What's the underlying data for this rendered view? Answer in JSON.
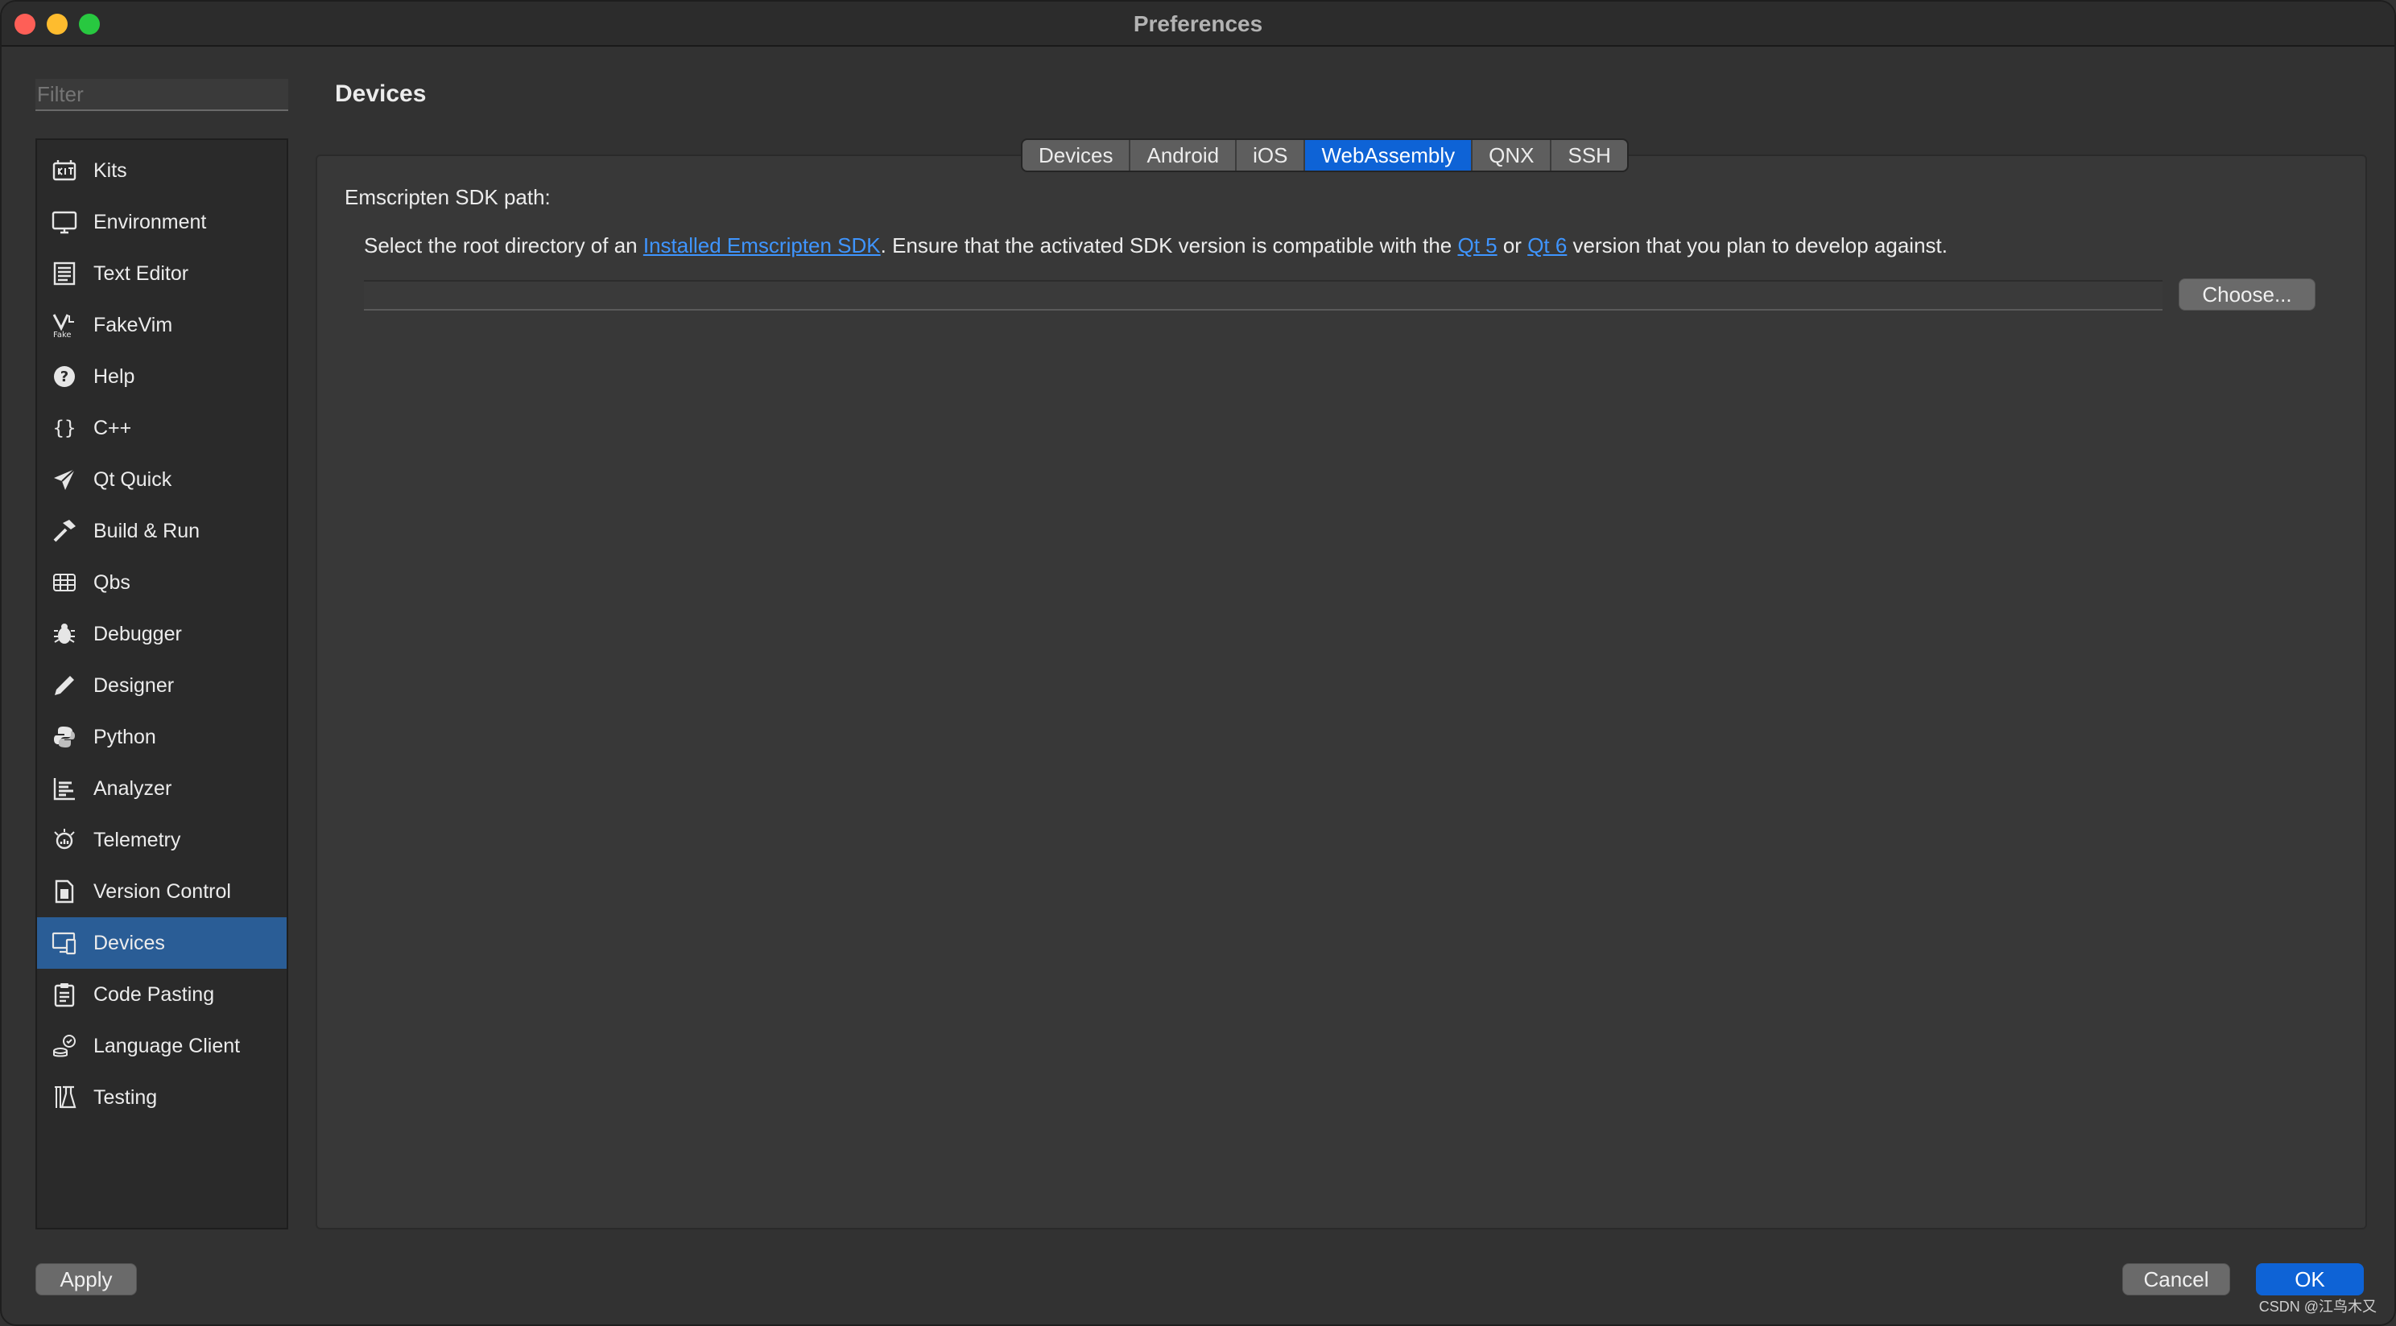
{
  "window": {
    "title": "Preferences"
  },
  "sidebar": {
    "filter_placeholder": "Filter",
    "items": [
      {
        "label": "Kits",
        "icon": "kits-icon"
      },
      {
        "label": "Environment",
        "icon": "monitor-icon"
      },
      {
        "label": "Text Editor",
        "icon": "text-editor-icon"
      },
      {
        "label": "FakeVim",
        "icon": "fakevim-icon"
      },
      {
        "label": "Help",
        "icon": "help-icon"
      },
      {
        "label": "C++",
        "icon": "braces-icon"
      },
      {
        "label": "Qt Quick",
        "icon": "paper-plane-icon"
      },
      {
        "label": "Build & Run",
        "icon": "hammer-icon"
      },
      {
        "label": "Qbs",
        "icon": "qbs-grid-icon"
      },
      {
        "label": "Debugger",
        "icon": "bug-icon"
      },
      {
        "label": "Designer",
        "icon": "pencil-icon"
      },
      {
        "label": "Python",
        "icon": "python-icon"
      },
      {
        "label": "Analyzer",
        "icon": "analyzer-icon"
      },
      {
        "label": "Telemetry",
        "icon": "telemetry-icon"
      },
      {
        "label": "Version Control",
        "icon": "version-control-icon"
      },
      {
        "label": "Devices",
        "icon": "devices-icon",
        "selected": true
      },
      {
        "label": "Code Pasting",
        "icon": "clipboard-icon"
      },
      {
        "label": "Language Client",
        "icon": "language-client-icon"
      },
      {
        "label": "Testing",
        "icon": "flask-icon"
      }
    ]
  },
  "main": {
    "title": "Devices",
    "tabs": [
      {
        "label": "Devices"
      },
      {
        "label": "Android"
      },
      {
        "label": "iOS"
      },
      {
        "label": "WebAssembly",
        "active": true
      },
      {
        "label": "QNX"
      },
      {
        "label": "SSH"
      }
    ],
    "section_label": "Emscripten SDK path:",
    "description": {
      "part1": "Select the root directory of an ",
      "link1": "Installed Emscripten SDK",
      "part2": ". Ensure that the activated SDK version is compatible with the ",
      "link2": "Qt 5",
      "part3": " or ",
      "link3": "Qt 6",
      "part4": " version that you plan to develop against."
    },
    "path_value": "",
    "choose_label": "Choose..."
  },
  "footer": {
    "apply_label": "Apply",
    "cancel_label": "Cancel",
    "ok_label": "OK"
  },
  "watermark": "CSDN @江鸟木又"
}
